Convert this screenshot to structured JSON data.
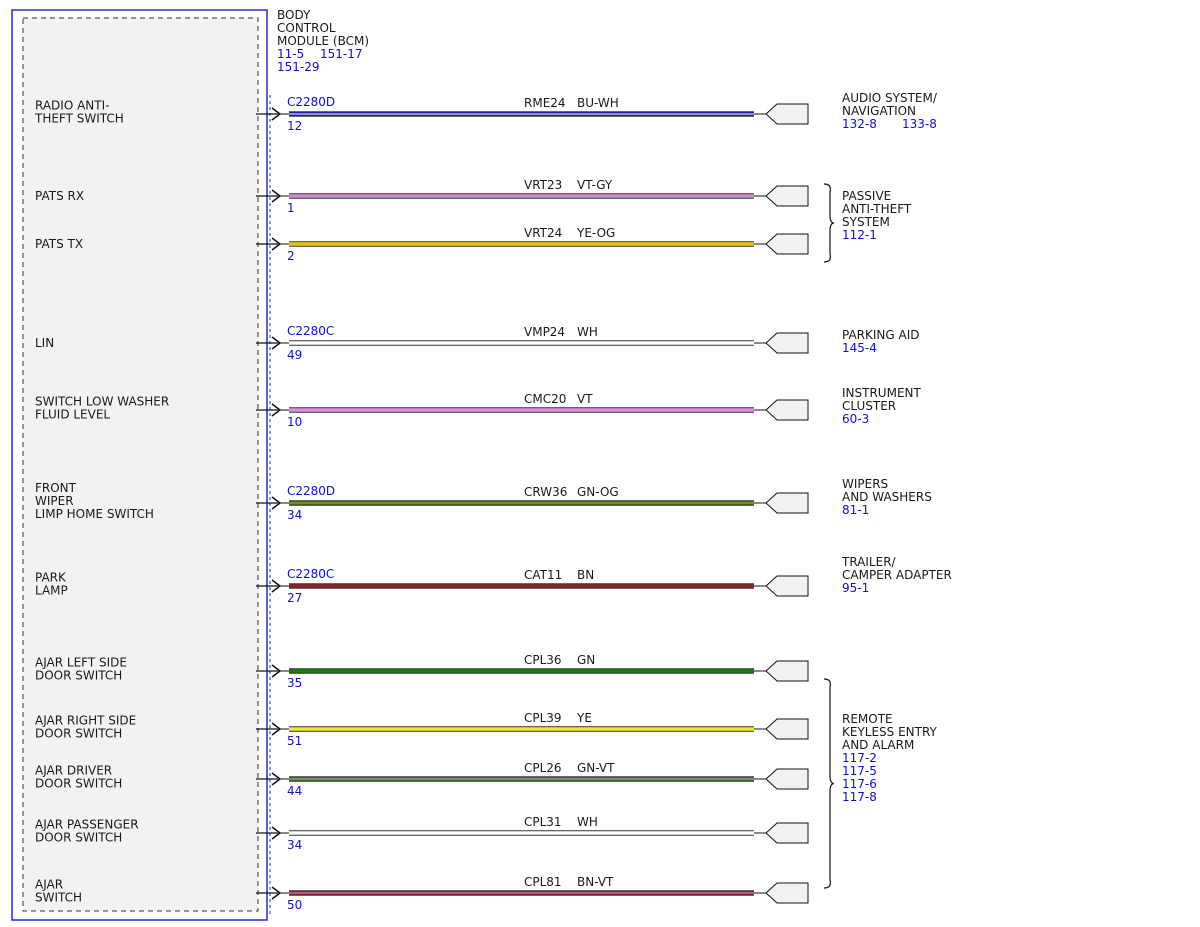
{
  "module": {
    "title_lines": [
      "BODY",
      "CONTROL",
      "MODULE (BCM)"
    ],
    "refs_line1": [
      "11-5",
      "151-17"
    ],
    "refs_line2": [
      "151-29"
    ]
  },
  "colors": {
    "BU-WH": [
      "#1a1ac8",
      "#ffffff"
    ],
    "VT-GY": [
      "#e58ce5",
      "#9a9a9a"
    ],
    "YE-OG": [
      "#f0e010",
      "#ff8c00"
    ],
    "WH": [
      "#ffffff",
      null
    ],
    "VT": [
      "#e58ce5",
      null
    ],
    "GN-OG": [
      "#2e7d10",
      "#ff8c00"
    ],
    "BN": [
      "#8b2323",
      null
    ],
    "GN": [
      "#108010",
      null
    ],
    "YE": [
      "#f0f020",
      null
    ],
    "GN-VT": [
      "#2e7d10",
      "#e58ce5"
    ],
    "BN-VT": [
      "#8b2323",
      "#e58ce5"
    ],
    "module_border": "#2a2ad0",
    "ref_text": "#1010d0"
  },
  "circuits": [
    {
      "label": [
        "RADIO ANTI-",
        "THEFT SWITCH"
      ],
      "connector": "C2280D",
      "pin": "12",
      "circuit": "RME24",
      "wire_color": "BU-WH"
    },
    {
      "label": [
        "PATS RX"
      ],
      "connector": "",
      "pin": "1",
      "circuit": "VRT23",
      "wire_color": "VT-GY"
    },
    {
      "label": [
        "PATS TX"
      ],
      "connector": "",
      "pin": "2",
      "circuit": "VRT24",
      "wire_color": "YE-OG"
    },
    {
      "label": [
        "LIN"
      ],
      "connector": "C2280C",
      "pin": "49",
      "circuit": "VMP24",
      "wire_color": "WH"
    },
    {
      "label": [
        "SWITCH LOW WASHER",
        "FLUID LEVEL"
      ],
      "connector": "",
      "pin": "10",
      "circuit": "CMC20",
      "wire_color": "VT"
    },
    {
      "label": [
        "FRONT",
        "WIPER",
        "LIMP HOME SWITCH"
      ],
      "connector": "C2280D",
      "pin": "34",
      "circuit": "CRW36",
      "wire_color": "GN-OG"
    },
    {
      "label": [
        "PARK",
        "LAMP"
      ],
      "connector": "C2280C",
      "pin": "27",
      "circuit": "CAT11",
      "wire_color": "BN"
    },
    {
      "label": [
        "AJAR LEFT SIDE",
        "DOOR SWITCH"
      ],
      "connector": "",
      "pin": "35",
      "circuit": "CPL36",
      "wire_color": "GN"
    },
    {
      "label": [
        "AJAR RIGHT SIDE",
        "DOOR SWITCH"
      ],
      "connector": "",
      "pin": "51",
      "circuit": "CPL39",
      "wire_color": "YE"
    },
    {
      "label": [
        "AJAR DRIVER",
        "DOOR SWITCH"
      ],
      "connector": "",
      "pin": "44",
      "circuit": "CPL26",
      "wire_color": "GN-VT"
    },
    {
      "label": [
        "AJAR PASSENGER",
        "DOOR SWITCH"
      ],
      "connector": "",
      "pin": "34",
      "circuit": "CPL31",
      "wire_color": "WH"
    },
    {
      "label": [
        "AJAR",
        "SWITCH"
      ],
      "connector": "",
      "pin": "50",
      "circuit": "CPL81",
      "wire_color": "BN-VT"
    }
  ],
  "destinations": [
    {
      "lines": [
        "AUDIO SYSTEM/",
        "NAVIGATION"
      ],
      "refs": [
        "132-8",
        "133-8"
      ],
      "refs_inline": true,
      "brace": false
    },
    {
      "lines": [
        "PASSIVE",
        "ANTI-THEFT",
        "SYSTEM"
      ],
      "refs": [
        "112-1"
      ],
      "refs_inline": false,
      "brace": true
    },
    {
      "lines": [
        "PARKING AID"
      ],
      "refs": [
        "145-4"
      ],
      "refs_inline": false,
      "brace": false
    },
    {
      "lines": [
        "INSTRUMENT",
        "CLUSTER"
      ],
      "refs": [
        "60-3"
      ],
      "refs_inline": false,
      "brace": false
    },
    {
      "lines": [
        "WIPERS",
        "AND WASHERS"
      ],
      "refs": [
        "81-1"
      ],
      "refs_inline": false,
      "brace": false
    },
    {
      "lines": [
        "TRAILER/",
        "CAMPER ADAPTER"
      ],
      "refs": [
        "95-1"
      ],
      "refs_inline": false,
      "brace": false
    },
    {
      "lines": [
        "REMOTE",
        "KEYLESS ENTRY",
        "AND ALARM"
      ],
      "refs": [
        "117-2",
        "117-5",
        "117-6",
        "117-8"
      ],
      "refs_inline": false,
      "brace": true
    }
  ]
}
